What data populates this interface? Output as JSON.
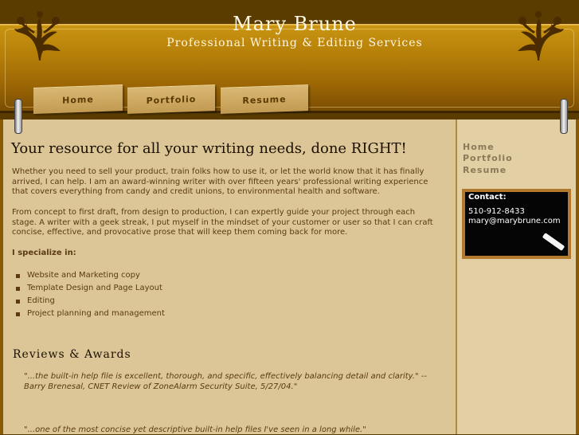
{
  "header": {
    "title": "Mary Brune",
    "subtitle": "Professional Writing & Editing Services",
    "tabs": [
      {
        "label": "Home"
      },
      {
        "label": "Portfolio"
      },
      {
        "label": "Resume"
      }
    ]
  },
  "main": {
    "headline": "Your resource for all your writing needs, done RIGHT!",
    "paragraphs": [
      "Whether you need to sell your product, train folks how to use it, or let the world know that it has finally arrived, I can help. I am an award-winning writer with over fifteen years' professional writing experience that covers everything from candy and credit unions, to environmental health and software.",
      "From concept to first draft, from design to production, I can expertly guide your project through each stage. A writer with a geek streak, I put myself in the mindset of your customer or user so that I can craft concise, effective, and provocative prose that will keep them coming back for more."
    ],
    "specialize_heading": "I specialize in:",
    "specialties": [
      "Website and Marketing copy",
      "Template Design and Page Layout",
      "Editing",
      "Project planning and management"
    ],
    "reviews_heading": "Reviews & Awards",
    "quotes": [
      "\"...the built-in help file is excellent, thorough, and specific, effectively balancing detail and clarity.\" --Barry Brenesal, CNET Review of ZoneAlarm Security Suite, 5/27/04.\"",
      "\"...one of the most concise yet descriptive built-in help files I've seen in a long while.\""
    ]
  },
  "sidebar": {
    "links": [
      {
        "label": "Home"
      },
      {
        "label": "Portfolio"
      },
      {
        "label": "Resume"
      }
    ],
    "contact": {
      "title": "Contact:",
      "phone": "510-912-8433",
      "email": "mary@marybrune.com"
    }
  },
  "colors": {
    "header_gold": "#b57f08",
    "background_brown": "#5a3c00",
    "content_tan": "#dcc698",
    "sidebar_tan": "#e2cfa3",
    "text_brown": "#5a3a12"
  },
  "icons": {
    "left_ornament": "flourish-ornament-icon",
    "right_ornament": "flourish-ornament-icon",
    "chalk": "chalk-icon"
  }
}
